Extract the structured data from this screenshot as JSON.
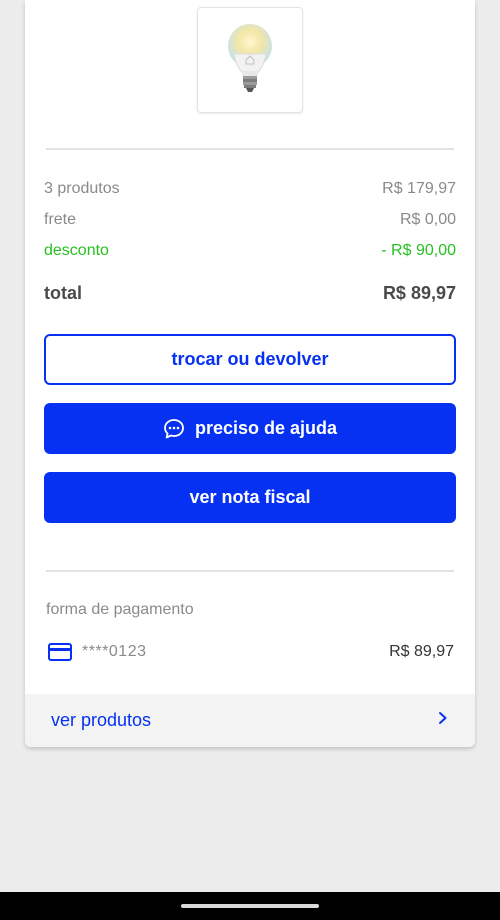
{
  "product": {
    "icon": "light-bulb-icon"
  },
  "summary": {
    "products_label": "3 produtos",
    "products_value": "R$ 179,97",
    "shipping_label": "frete",
    "shipping_value": "R$ 0,00",
    "discount_label": "desconto",
    "discount_value": "- R$ 90,00",
    "total_label": "total",
    "total_value": "R$ 89,97"
  },
  "actions": {
    "exchange_label": "trocar ou devolver",
    "help_label": "preciso de ajuda",
    "help_icon": "chat-bubble-icon",
    "invoice_label": "ver nota fiscal"
  },
  "payment": {
    "section_label": "forma de pagamento",
    "card_icon": "credit-card-icon",
    "card_masked": "****0123",
    "amount": "R$ 89,97"
  },
  "footer": {
    "label": "ver produtos",
    "icon": "chevron-right-icon"
  },
  "colors": {
    "primary": "#0631f2",
    "discount": "#25c11f",
    "muted": "#8a8a8a"
  }
}
